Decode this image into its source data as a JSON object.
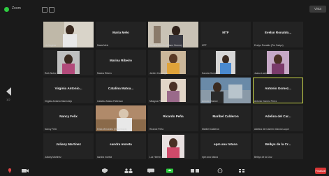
{
  "window": {
    "title": "Zoom"
  },
  "topbar": {
    "view_label": "Vista"
  },
  "sidebar": {
    "page_indicator": "1/2"
  },
  "tiles": [
    {
      "name": "",
      "label": "Liv Virginia"
    },
    {
      "name": "Maria Melo",
      "label": "Maria Melo"
    },
    {
      "name": "",
      "label": "Cristina Correia (Eliane Gomes)"
    },
    {
      "name": "MTF",
      "label": "MTF"
    },
    {
      "name": "Evelyn Ronaldo...",
      "label": "Evelyn Ronaldo (Pre Sadyo)"
    },
    {
      "name": "",
      "label": "Ruth Nobre"
    },
    {
      "name": "Marina Ribeiro",
      "label": "Marina Ribeiro"
    },
    {
      "name": "",
      "label": "Jenifer Conceição"
    },
    {
      "name": "",
      "label": "Sandra Gomes"
    },
    {
      "name": "",
      "label": "Joana Lucimar"
    },
    {
      "name": "Virginia Antonio...",
      "label": "Virginia Antonio Marmolejo"
    },
    {
      "name": "Catalina Matoa...",
      "label": "Catalina Matoa Patterson"
    },
    {
      "name": "",
      "label": "Milagros Pena"
    },
    {
      "name": "",
      "label": "Antonio Gomez"
    },
    {
      "name": "Antonio Gomez...",
      "label": "Antonio Gomez Perez"
    },
    {
      "name": "Nancy Felix",
      "label": "Nancy Felix"
    },
    {
      "name": "",
      "label": "Erika Mercedes (Erika Maya)"
    },
    {
      "name": "Ricardo Peña",
      "label": "Ricardo Peña"
    },
    {
      "name": "Maribel Calderon",
      "label": "Maribel Calderon"
    },
    {
      "name": "Adelina del Car...",
      "label": "Adelina del Carmen Garcia Luque"
    },
    {
      "name": "Juliany Martinez",
      "label": "Juliany Martinez"
    },
    {
      "name": "sandra moreta",
      "label": "sandra moreta"
    },
    {
      "name": "",
      "label": "Luz Herrera"
    },
    {
      "name": "epm ana totana",
      "label": "epm ana totana"
    },
    {
      "name": "Belkys de la Cr...",
      "label": "Belkys de la Cruz"
    }
  ],
  "bottombar": {
    "end_label": "Finalizar"
  }
}
